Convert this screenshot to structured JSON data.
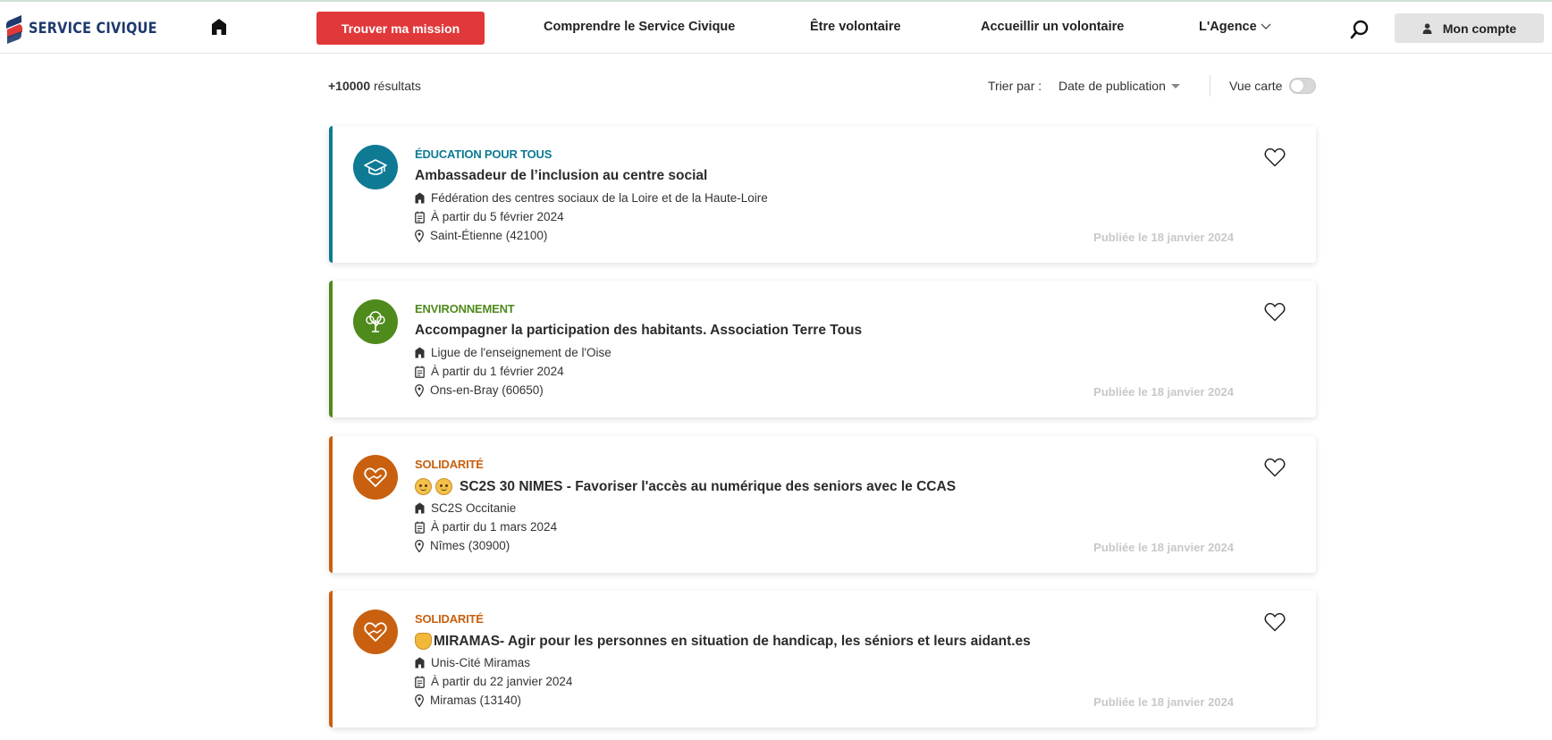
{
  "header": {
    "logo_text": "SERVICE CIVIQUE",
    "cta_label": "Trouver ma mission",
    "nav": [
      {
        "label": "Comprendre le Service Civique"
      },
      {
        "label": "Être volontaire"
      },
      {
        "label": "Accueillir un volontaire"
      },
      {
        "label": "L'Agence"
      }
    ],
    "account_label": "Mon compte"
  },
  "toolbar": {
    "results_count": "+10000",
    "results_suffix": " résultats",
    "sort_label": "Trier par :",
    "sort_value": "Date de publication",
    "map_label": "Vue carte",
    "map_view_enabled": false
  },
  "colors": {
    "cta": "#e1383a",
    "education": "#0e7a94",
    "environnement": "#4f8a1c",
    "solidarite": "#c8600f",
    "logo_blue": "#1e3a6e"
  },
  "missions": [
    {
      "category": "ÉDUCATION POUR TOUS",
      "category_icon": "graduation-cap-icon",
      "title": "Ambassadeur de l’inclusion au centre social",
      "organization": "Fédération des centres sociaux de la Loire et de la Haute-Loire",
      "start": "À partir du 5 février 2024",
      "location": "Saint-Étienne (42100)",
      "published": "Publiée le 18 janvier 2024"
    },
    {
      "category": "ENVIRONNEMENT",
      "category_icon": "tree-icon",
      "title": "Accompagner la participation des habitants. Association Terre Tous",
      "organization": "Ligue de l'enseignement de l'Oise",
      "start": "À partir du 1 février 2024",
      "location": "Ons-en-Bray (60650)",
      "published": "Publiée le 18 janvier 2024"
    },
    {
      "category": "SOLIDARITÉ",
      "category_icon": "heart-hand-icon",
      "title": "SC2S 30 NIMES - Favoriser l'accès au numérique des seniors avec le CCAS",
      "title_emojis": [
        "older-man-emoji",
        "older-woman-emoji"
      ],
      "organization": "SC2S Occitanie",
      "start": "À partir du 1 mars 2024",
      "location": "Nîmes (30900)",
      "published": "Publiée le 18 janvier 2024"
    },
    {
      "category": "SOLIDARITÉ",
      "category_icon": "heart-hand-icon",
      "title": "MIRAMAS- Agir pour les personnes en situation de handicap, les séniors et leurs aidant.es",
      "title_emojis": [
        "handshake-emoji"
      ],
      "organization": "Unis-Cité Miramas",
      "start": "À partir du 22 janvier 2024",
      "location": "Miramas (13140)",
      "published": "Publiée le 18 janvier 2024"
    }
  ]
}
